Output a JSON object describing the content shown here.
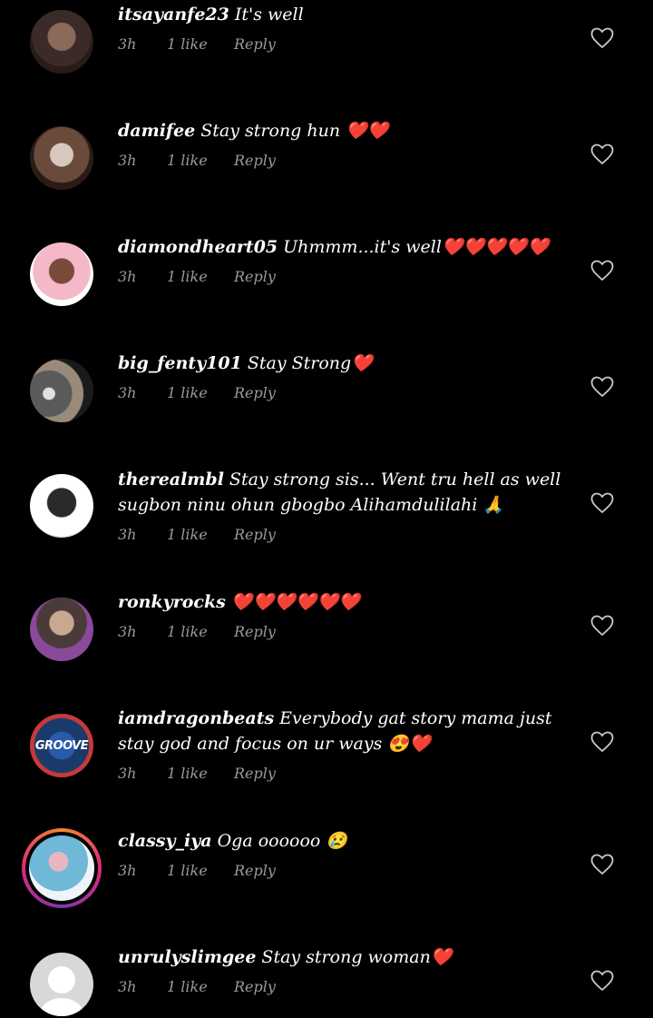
{
  "comments": [
    {
      "username": "itsayanfe23",
      "text": "It's well",
      "time": "3h",
      "likes": "1 like",
      "reply": "Reply",
      "avatar": "photo",
      "avatar_colors": [
        "#3a2a28",
        "#8a6a5a",
        "#2a1a18"
      ]
    },
    {
      "username": "damifee",
      "text": "Stay strong hun ❤️❤️",
      "time": "3h",
      "likes": "1 like",
      "reply": "Reply",
      "avatar": "photo",
      "avatar_colors": [
        "#6a4a3a",
        "#d8c8c0",
        "#2a1a18"
      ]
    },
    {
      "username": "diamondheart05",
      "text": "Uhmmm...it's well❤️❤️❤️❤️❤️",
      "time": "3h",
      "likes": "1 like",
      "reply": "Reply",
      "avatar": "photo",
      "avatar_colors": [
        "#f4b8c8",
        "#7a4a3a",
        "#ffffff"
      ]
    },
    {
      "username": "big_fenty101",
      "text": "Stay Strong❤️",
      "time": "3h",
      "likes": "1 like",
      "reply": "Reply",
      "avatar": "photo",
      "avatar_colors": [
        "#5a5a5a",
        "#9a8a7a",
        "#1a1a1a"
      ]
    },
    {
      "username": "therealmbl",
      "text": "Stay strong sis... Went tru hell as well sugbon ninu ohun gbogbo Alihamdulilahi 🙏",
      "time": "3h",
      "likes": "1 like",
      "reply": "Reply",
      "avatar": "photo",
      "avatar_colors": [
        "#ffffff",
        "#2a2a2a",
        "#e0e0e0"
      ]
    },
    {
      "username": "ronkyrocks",
      "text": "❤️❤️❤️❤️❤️❤️",
      "time": "3h",
      "likes": "1 like",
      "reply": "Reply",
      "avatar": "photo",
      "avatar_colors": [
        "#c8a890",
        "#8a4a9a",
        "#4a3a3a"
      ]
    },
    {
      "username": "iamdragonbeats",
      "text": "Everybody gat story mama just stay god and focus on ur ways 😍❤️",
      "time": "3h",
      "likes": "1 like",
      "reply": "Reply",
      "avatar": "photo",
      "avatar_colors": [
        "#1a3a6a",
        "#c83a3a",
        "#2a5aaa"
      ],
      "avatar_text": "GROOVE"
    },
    {
      "username": "classy_iya",
      "text": "Oga oooooo 😢",
      "time": "3h",
      "likes": "1 like",
      "reply": "Reply",
      "avatar": "story"
    },
    {
      "username": "unrulyslimgee",
      "text": "Stay strong woman❤️",
      "time": "3h",
      "likes": "1 like",
      "reply": "Reply",
      "avatar": "blank"
    }
  ],
  "icons": {
    "like": "heart-outline-icon"
  },
  "colors": {
    "background": "#000000",
    "text": "#ffffff",
    "meta": "#9a9a9a"
  }
}
